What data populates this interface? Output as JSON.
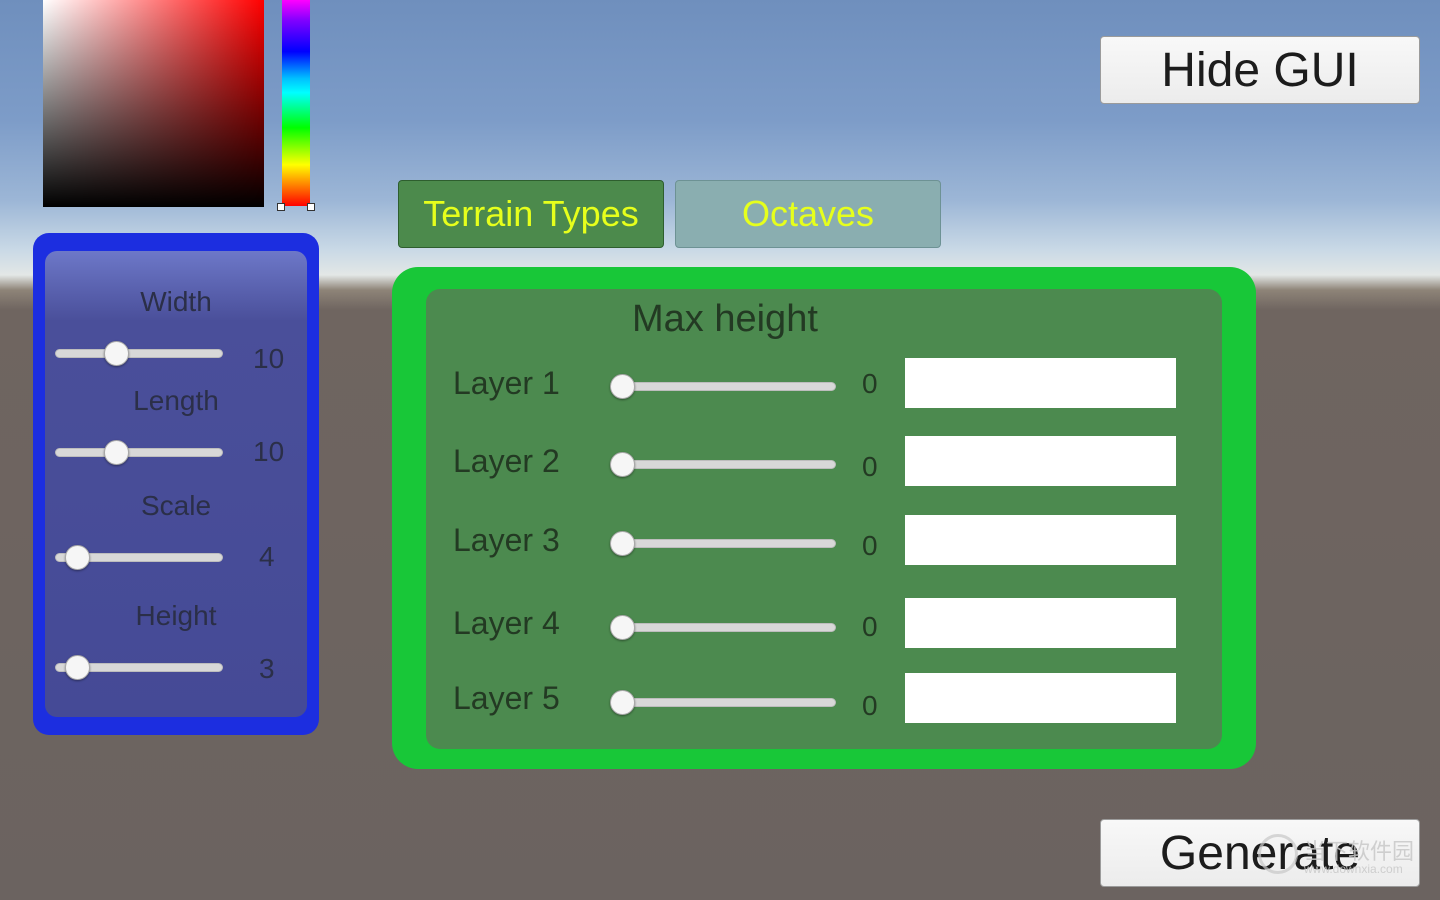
{
  "color_picker": {
    "hue_slider_value": 0
  },
  "terrain_settings": {
    "width": {
      "label": "Width",
      "value": "10"
    },
    "length": {
      "label": "Length",
      "value": "10"
    },
    "scale": {
      "label": "Scale",
      "value": "4"
    },
    "height": {
      "label": "Height",
      "value": "3"
    }
  },
  "tabs": [
    {
      "label": "Terrain Types",
      "selected": true
    },
    {
      "label": "Octaves",
      "selected": false
    }
  ],
  "terrain_types": {
    "title": "Max height",
    "layers": [
      {
        "label": "Layer 1",
        "value": "0",
        "input": ""
      },
      {
        "label": "Layer 2",
        "value": "0",
        "input": ""
      },
      {
        "label": "Layer 3",
        "value": "0",
        "input": ""
      },
      {
        "label": "Layer 4",
        "value": "0",
        "input": ""
      },
      {
        "label": "Layer 5",
        "value": "0",
        "input": ""
      }
    ]
  },
  "buttons": {
    "hide_gui": "Hide GUI",
    "generate": "Generate"
  },
  "watermark": {
    "text": "当下软件园",
    "sub": "www.downxia.com"
  },
  "colors": {
    "left_panel_border": "#1c2ee0",
    "green_panel_border": "#18c738",
    "tab_text": "#e6ff1c"
  }
}
